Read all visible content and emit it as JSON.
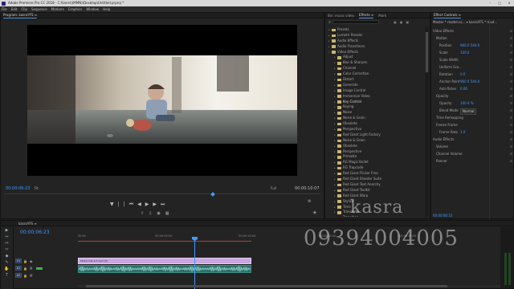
{
  "window": {
    "title": "Adobe Premiere Pro CC 2018 - C:\\Users\\(MMN)\\Desktop\\Untitled.prproj *"
  },
  "menu": [
    "File",
    "Edit",
    "Clip",
    "Sequence",
    "Markers",
    "Graphics",
    "Window",
    "Help"
  ],
  "program": {
    "tab": "Program: kasraYFS ≡",
    "timecode": "00:00:06:23",
    "fit": "Fit",
    "quality": "Full",
    "duration": "00:00:10:07"
  },
  "effects_panel": {
    "tabs": [
      "Bin: music video",
      "Effects ≡",
      "Mark"
    ],
    "items": [
      {
        "label": "Presets",
        "level": 0
      },
      {
        "label": "Lumetri Presets",
        "level": 0
      },
      {
        "label": "Audio Effects",
        "level": 0
      },
      {
        "label": "Audio Transitions",
        "level": 0
      },
      {
        "label": "Video Effects",
        "level": 0,
        "open": true
      },
      {
        "label": "Adjust",
        "level": 1
      },
      {
        "label": "Blur & Sharpen",
        "level": 1
      },
      {
        "label": "Channel",
        "level": 1
      },
      {
        "label": "Color Correction",
        "level": 1
      },
      {
        "label": "Distort",
        "level": 1
      },
      {
        "label": "Generate",
        "level": 1
      },
      {
        "label": "Image Control",
        "level": 1
      },
      {
        "label": "Immersive Video",
        "level": 1
      },
      {
        "label": "Key Control",
        "level": 1,
        "selected": true
      },
      {
        "label": "Keying",
        "level": 1
      },
      {
        "label": "Noise",
        "level": 1
      },
      {
        "label": "Noise & Grain",
        "level": 1
      },
      {
        "label": "Obsolete",
        "level": 1
      },
      {
        "label": "Perspective",
        "level": 1
      },
      {
        "label": "Red Giant Light Factory",
        "level": 1
      },
      {
        "label": "Noise & Grain",
        "level": 1
      },
      {
        "label": "Obsolete",
        "level": 1
      },
      {
        "label": "Perspective",
        "level": 1
      },
      {
        "label": "Primatte",
        "level": 1
      },
      {
        "label": "RG Magic Bullet",
        "level": 1
      },
      {
        "label": "RG Trapcode",
        "level": 1
      },
      {
        "label": "Red Giant Flicker Free",
        "level": 1
      },
      {
        "label": "Red Giant Shooter Suite",
        "level": 1
      },
      {
        "label": "Red Giant Text Anarchy",
        "level": 1
      },
      {
        "label": "Red Giant Toolkit",
        "level": 1
      },
      {
        "label": "Red Giant Warp",
        "level": 1
      },
      {
        "label": "Stylize",
        "level": 1
      },
      {
        "label": "Time",
        "level": 1
      },
      {
        "label": "Transform",
        "level": 1
      },
      {
        "label": "Transition",
        "level": 1
      },
      {
        "label": "Utility",
        "level": 1
      }
    ]
  },
  "effect_controls": {
    "tabs": [
      "Effect Controls ≡"
    ],
    "source_line": "Master * model.co... ▾   kasraYFS * mod...",
    "rows": [
      {
        "label": "Video Effects",
        "value": ""
      },
      {
        "label": "Motion",
        "value": ""
      },
      {
        "label": "Position",
        "value": "960.0   540.0"
      },
      {
        "label": "Scale",
        "value": "100.0"
      },
      {
        "label": "Scale Width",
        "value": ""
      },
      {
        "label": "Uniform Sca...",
        "value": ""
      },
      {
        "label": "Rotation",
        "value": "0.0"
      },
      {
        "label": "Anchor Point",
        "value": "960.0   540.0"
      },
      {
        "label": "Anti-flicker",
        "value": "0.00"
      },
      {
        "label": "Opacity",
        "value": ""
      },
      {
        "label": "Opacity",
        "value": "100.0 %"
      },
      {
        "label": "Blend Mode",
        "value": "Normal"
      },
      {
        "label": "Time Remapping",
        "value": ""
      },
      {
        "label": "Freeze Frame",
        "value": ""
      },
      {
        "label": "Frame Rate",
        "value": "1.0"
      },
      {
        "label": "Audio Effects",
        "value": ""
      },
      {
        "label": "Volume",
        "value": ""
      },
      {
        "label": "Channel Volume",
        "value": ""
      },
      {
        "label": "Panner",
        "value": ""
      }
    ],
    "timecode": "00:00:06:23"
  },
  "timeline": {
    "tab": "kasraYFS ≡",
    "timecode": "00:00:06:23",
    "ruler": [
      "00:00",
      "00:00:05:00",
      "00:00:10:00",
      "00:00:15:00",
      "00:00:20:00"
    ],
    "tracks": [
      "V1",
      "A1",
      "A2"
    ],
    "video_clip_label": "Model.Inst.act.mp4 [V]"
  },
  "tools": [
    "▶",
    "⇔",
    "↔",
    "✂",
    "◆",
    "✎",
    "✋",
    "T"
  ],
  "watermark": {
    "name": "kasra",
    "phone": "09394004005"
  },
  "colors": {
    "accent": "#3e9bff",
    "clip_video": "#c9a6e0",
    "clip_audio": "#2a6f6a"
  }
}
